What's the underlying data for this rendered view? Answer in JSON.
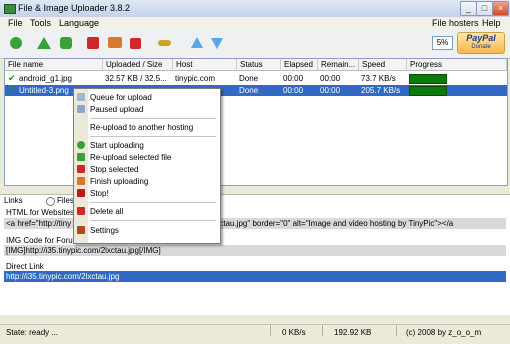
{
  "window": {
    "title": "File & Image Uploader 3.8.2"
  },
  "menubar": {
    "left": [
      "File",
      "Tools",
      "Language"
    ],
    "right": [
      "File hosters",
      "Help"
    ]
  },
  "toolbar": {
    "icons": [
      "add-icon",
      "upload-icon",
      "upload-all-icon",
      "stop-icon",
      "reupload-icon",
      "delete-icon",
      "key-icon",
      "move-up-icon",
      "move-down-icon"
    ],
    "zoom": "5%",
    "paypal": {
      "logo": "PayPal",
      "label": "Donate"
    }
  },
  "list": {
    "columns": [
      "File name",
      "Uploaded / Size",
      "Host",
      "Status",
      "Elapsed",
      "Remain...",
      "Speed",
      "Progress"
    ],
    "rows": [
      {
        "name": "android_g1.jpg",
        "size": "32.57 KB / 32.5...",
        "host": "tinypic.com",
        "status": "Done",
        "elapsed": "00:00",
        "remain": "00:00",
        "speed": "73.7 KB/s",
        "progress": 1.0,
        "selected": false
      },
      {
        "name": "Untitled-3.png",
        "size": "",
        "host": "",
        "status": "Done",
        "elapsed": "00:00",
        "remain": "00:00",
        "speed": "205.7 KB/s",
        "progress": 1.0,
        "selected": true
      }
    ]
  },
  "context_menu": {
    "items": [
      {
        "label": "Queue for upload",
        "icon": "queue-icon"
      },
      {
        "label": "Paused upload",
        "icon": "pause-icon"
      },
      {
        "sep": true
      },
      {
        "label": "Re-upload to another hosting",
        "icon": ""
      },
      {
        "sep": true
      },
      {
        "label": "Start uploading",
        "icon": "upload-icon"
      },
      {
        "label": "Re-upload selected file",
        "icon": "upload-all-icon"
      },
      {
        "label": "Stop selected",
        "icon": "stop-icon"
      },
      {
        "label": "Finish uploading",
        "icon": "finish-icon"
      },
      {
        "label": "Stop!",
        "icon": "stop-all-icon"
      },
      {
        "sep": true
      },
      {
        "label": "Delete all",
        "icon": "delete-icon"
      },
      {
        "sep": true
      },
      {
        "label": "Settings",
        "icon": "settings-icon"
      }
    ]
  },
  "links": {
    "label": "Links",
    "files_label": "Files",
    "html_header": "HTML for Websites",
    "html_value": "<a href=\"http://tiny",
    "html_value_right": "i35.tinypic.com/2lxctau.jpg\" border=\"0\" alt=\"Image and video hosting by TinyPic\"></a",
    "img_header": "IMG Code for Forum",
    "img_value": "[IMG]http://i35.tinypic.com/2lxctau.jpg[/IMG]",
    "direct_header": "Direct Link",
    "direct_value": "http://i35.tinypic.com/2lxctau.jpg"
  },
  "statusbar": {
    "state": "State: ready ...",
    "speed": "0 KB/s",
    "size": "192.92 KB",
    "copyright": "(c) 2008 by z_o_o_m"
  }
}
